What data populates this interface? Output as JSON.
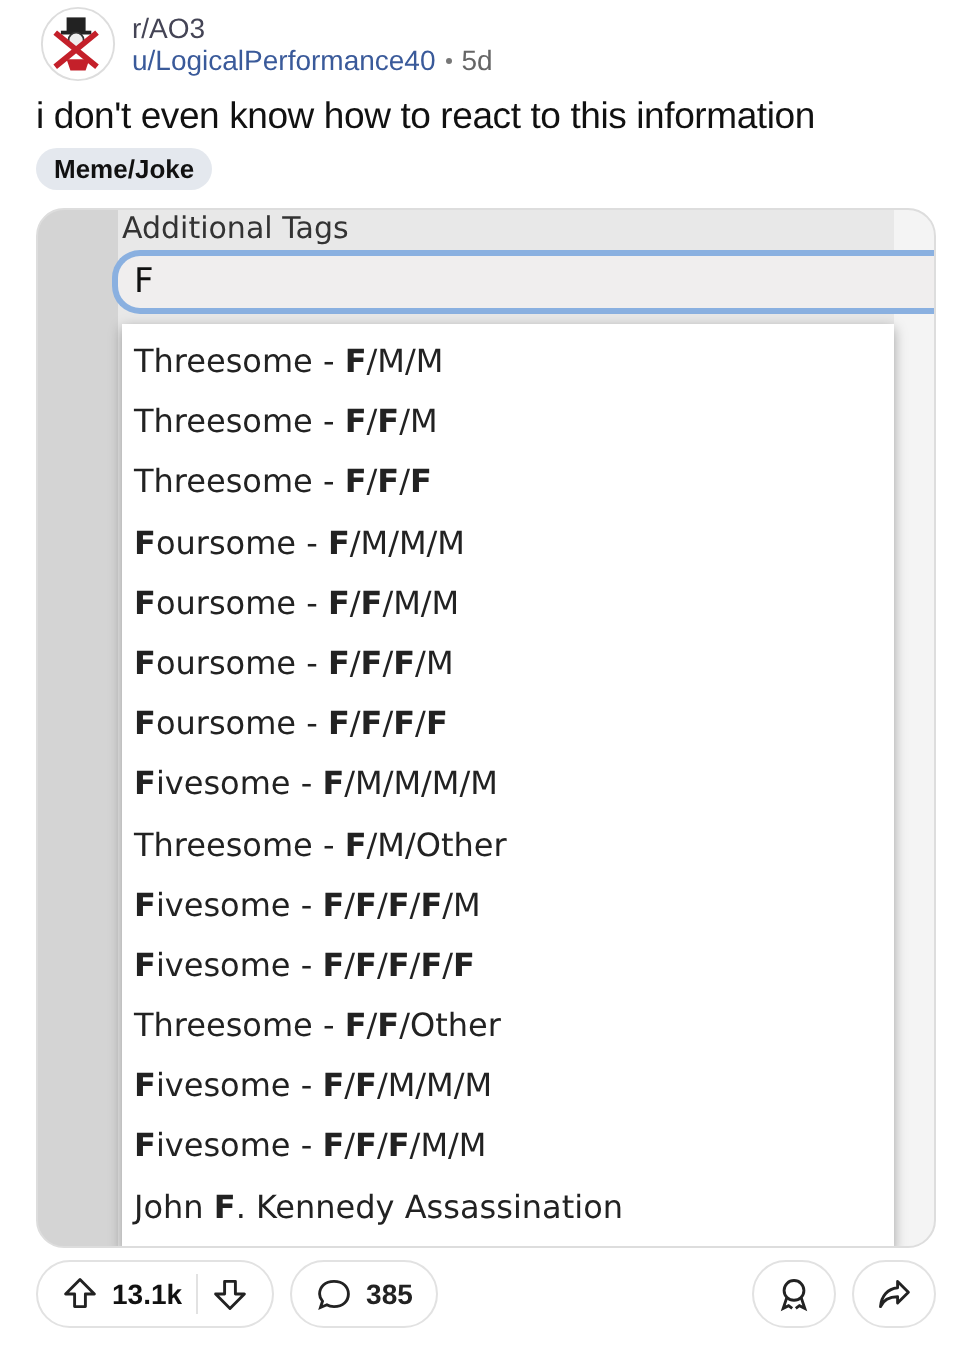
{
  "post": {
    "subreddit": "r/AO3",
    "author": "u/LogicalPerformance40",
    "age": "5d",
    "title": "i don't even know how to react to this information",
    "flair": "Meme/Joke"
  },
  "screenshot": {
    "field_label": "Additional Tags",
    "input_value": "F",
    "suggestions": [
      "Threesome - **F**/M/M",
      "Threesome - **F**/**F**/M",
      "Threesome - **F**/**F**/**F**",
      "**F**oursome - **F**/M/M/M",
      "**F**oursome - **F**/**F**/M/M",
      "**F**oursome - **F**/**F**/**F**/M",
      "**F**oursome - **F**/**F**/**F**/**F**",
      "**F**ivesome - **F**/M/M/M/M",
      "Threesome - **F**/M/Other",
      "**F**ivesome - **F**/**F**/**F**/**F**/M",
      "**F**ivesome - **F**/**F**/**F**/**F**/**F**",
      "Threesome - **F**/**F**/Other",
      "**F**ivesome - **F**/**F**/M/M/M",
      "**F**ivesome - **F**/**F**/**F**/M/M",
      "John **F**. Kennedy Assassination"
    ]
  },
  "actions": {
    "upvotes": "13.1k",
    "comments": "385"
  }
}
